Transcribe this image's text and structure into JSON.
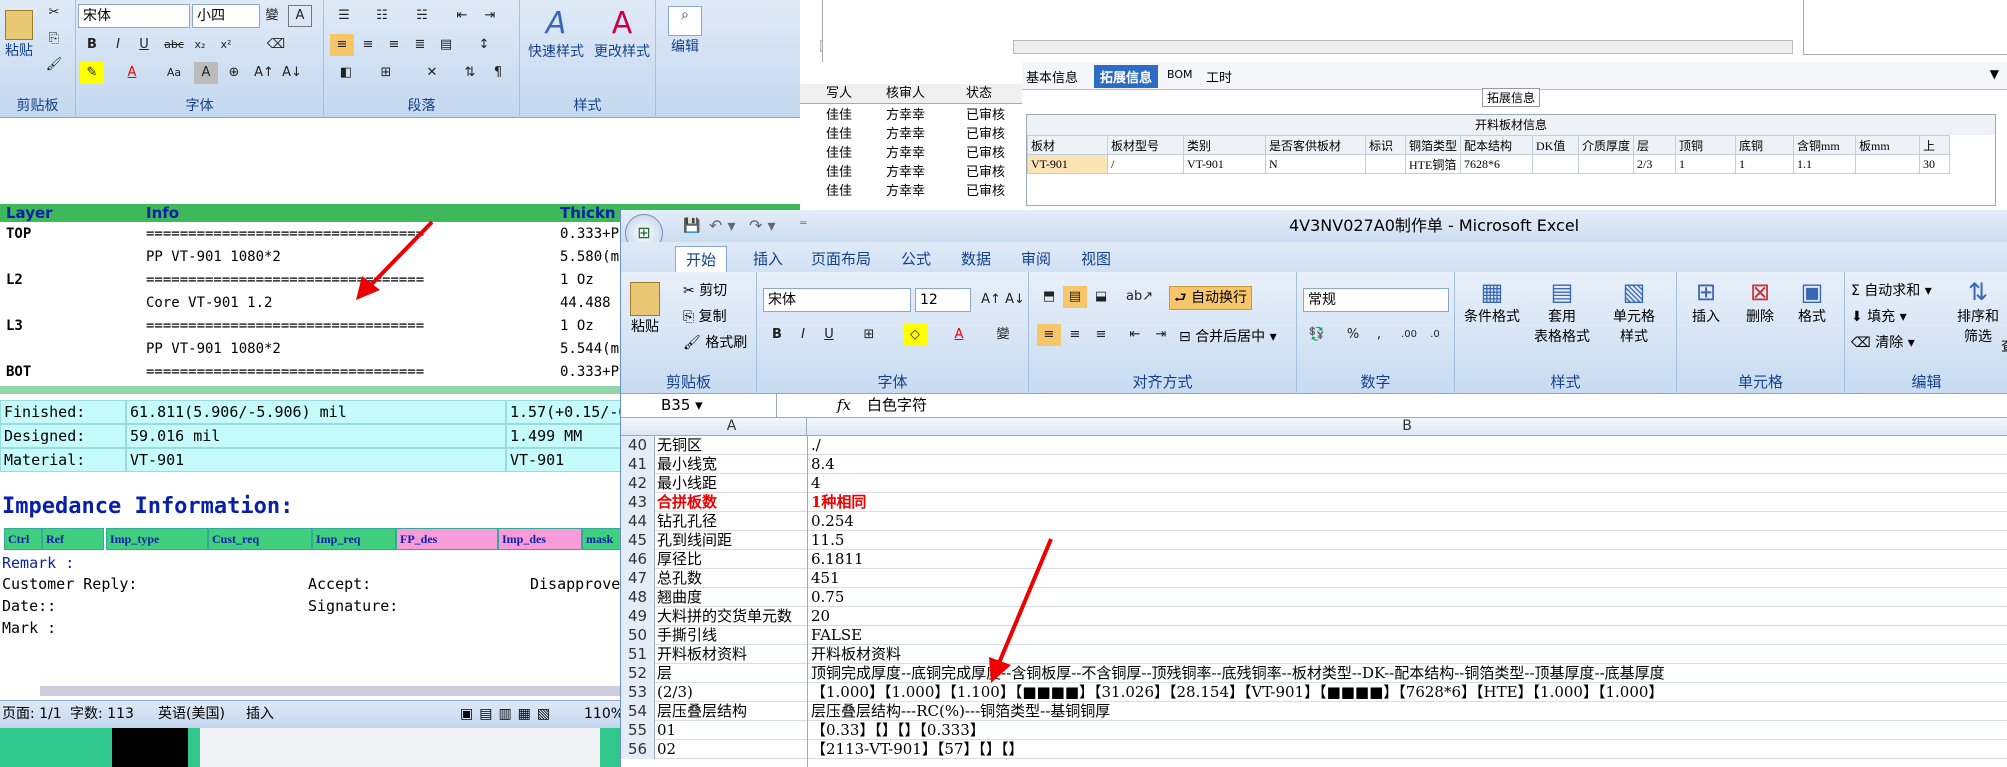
{
  "word": {
    "font_name": "宋体",
    "font_size": "小四",
    "groups": {
      "clipboard": "剪贴板",
      "font": "字体",
      "paragraph": "段落",
      "styles": "样式"
    },
    "paste": "粘贴",
    "quick_styles": "快速样式",
    "change_styles": "更改样式",
    "editing": "编辑",
    "layer_header": [
      "Layer",
      "Info",
      "Thickn"
    ],
    "layers": [
      {
        "name": "TOP",
        "info": "=================================",
        "thk": "0.333+P"
      },
      {
        "name": "",
        "info": "PP     VT-901     1080*2",
        "thk": "5.580(m"
      },
      {
        "name": "L2",
        "info": "=================================",
        "thk": "1 Oz"
      },
      {
        "name": "",
        "info": "Core     VT-901     1.2",
        "thk": "44.488"
      },
      {
        "name": "L3",
        "info": "=================================",
        "thk": "1 Oz"
      },
      {
        "name": "",
        "info": "PP     VT-901     1080*2",
        "thk": "5.544(m"
      },
      {
        "name": "BOT",
        "info": "=================================",
        "thk": "0.333+P"
      }
    ],
    "specs": [
      {
        "k": "Finished:",
        "v": "61.811(5.906/-5.906) mil",
        "w": "1.57(+0.15/-0"
      },
      {
        "k": "Designed:",
        "v": "59.016 mil",
        "w": "1.499 MM"
      },
      {
        "k": "Material:",
        "v": "VT-901",
        "w": "VT-901"
      }
    ],
    "impedance_title": "Impedance Information:",
    "imp_cols": [
      "Ctrl",
      "Ref",
      "Imp_type",
      "Cust_req",
      "Imp_req",
      "FP_des",
      "Imp_des",
      "mask"
    ],
    "remark": "Remark :",
    "customer_reply": "Customer Reply:",
    "accept": "Accept:",
    "disapprove": "Disapprove",
    "date": "Date::",
    "signature": "Signature:",
    "mark": "Mark :",
    "status": {
      "page": "页面: 1/1",
      "words": "字数: 113",
      "lang": "英语(美国)",
      "insert": "插入",
      "zoom": "110%"
    }
  },
  "mid": {
    "headers": [
      "写人",
      "核审人",
      "状态"
    ],
    "rows": [
      [
        "佳佳",
        "方幸幸",
        "已审核"
      ],
      [
        "佳佳",
        "方幸幸",
        "已审核"
      ],
      [
        "佳佳",
        "方幸幸",
        "已审核"
      ],
      [
        "佳佳",
        "方幸幸",
        "已审核"
      ],
      [
        "佳佳",
        "方幸幸",
        "已审核"
      ]
    ]
  },
  "right": {
    "tabs": [
      "基本信息",
      "拓展信息",
      "BOM",
      "工时"
    ],
    "section": "拓展信息",
    "table_title": "开料板材信息",
    "headers": [
      "板材",
      "板材型号",
      "类别",
      "是否客供板材",
      "标识",
      "铜箔类型",
      "配本结构",
      "DK值",
      "介质厚度",
      "层",
      "顶铜",
      "底铜",
      "含铜mm",
      "板mm",
      "上"
    ],
    "row": [
      "VT-901",
      "/",
      "VT-901",
      "N",
      "",
      "HTE铜箔",
      "7628*6",
      "",
      "",
      "2/3",
      "1",
      "1",
      "1.1",
      "",
      "30"
    ]
  },
  "excel": {
    "title": "4V3NV027A0制作单 - Microsoft Excel",
    "tabs": [
      "开始",
      "插入",
      "页面布局",
      "公式",
      "数据",
      "审阅",
      "视图"
    ],
    "clipboard": {
      "paste": "粘贴",
      "cut": "剪切",
      "copy": "复制",
      "fmt": "格式刷",
      "label": "剪贴板"
    },
    "font": {
      "name": "宋体",
      "size": "12",
      "label": "字体"
    },
    "align": {
      "wrap": "自动换行",
      "merge": "合并后居中",
      "label": "对齐方式"
    },
    "number": {
      "fmt": "常规",
      "label": "数字"
    },
    "styles": {
      "cond": "条件格式",
      "table": "套用\n表格格式",
      "cell": "单元格\n样式",
      "label": "样式"
    },
    "cells": {
      "insert": "插入",
      "delete": "删除",
      "format": "格式",
      "label": "单元格"
    },
    "edit": {
      "sum": "自动求和",
      "fill": "填充",
      "clear": "清除",
      "sort": "排序和\n筛选",
      "find": "查",
      "label": "编辑"
    },
    "name_box": "B35",
    "formula": "白色字符",
    "col_a": "A",
    "col_b": "B",
    "rows": [
      [
        "40",
        "无铜区",
        "./"
      ],
      [
        "41",
        "最小线宽",
        "8.4"
      ],
      [
        "42",
        "最小线距",
        "4"
      ],
      [
        "43",
        "合拼板数",
        "1种相同"
      ],
      [
        "44",
        "钻孔孔径",
        "0.254"
      ],
      [
        "45",
        "孔到线间距",
        "11.5"
      ],
      [
        "46",
        "厚径比",
        "6.1811"
      ],
      [
        "47",
        "总孔数",
        "451"
      ],
      [
        "48",
        "翘曲度",
        "0.75"
      ],
      [
        "49",
        "大料拼的交货单元数",
        "20"
      ],
      [
        "50",
        "手撕引线",
        "FALSE"
      ],
      [
        "51",
        "开料板材资料",
        "开料板材资料"
      ],
      [
        "52",
        "层",
        "顶铜完成厚度--底铜完成厚度--含铜板厚--不含铜厚--顶残铜率--底残铜率--板材类型--DK--配本结构--铜箔类型--顶基厚度--底基厚度"
      ],
      [
        "53",
        "(2/3)",
        "【1.000】【1.000】【1.100】【■■■■】【31.026】【28.154】【VT-901】【■■■■】【7628*6】【HTE】【1.000】【1.000】"
      ],
      [
        "54",
        "层压叠层结构",
        "层压叠层结构---RC(%)---铜箔类型--基铜铜厚"
      ],
      [
        "55",
        "01",
        "【0.33】【】【】【0.333】"
      ],
      [
        "56",
        "02",
        "【2113-VT-901】【57】【】【】"
      ]
    ]
  }
}
